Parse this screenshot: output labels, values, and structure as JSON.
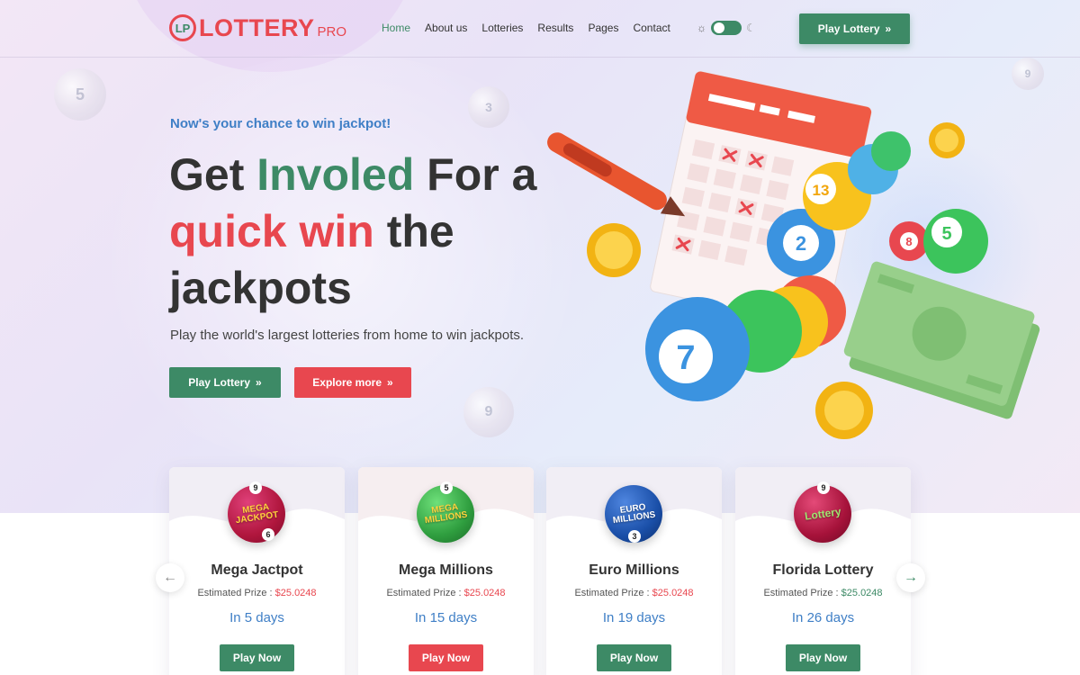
{
  "header": {
    "logo_mark": "LP",
    "logo_word": "LOTTERY",
    "logo_suffix": "PRO",
    "nav": [
      "Home",
      "About us",
      "Lotteries",
      "Results",
      "Pages",
      "Contact"
    ],
    "cta_label": "Play Lottery"
  },
  "hero": {
    "tagline": "Now's your chance to win jackpot!",
    "headline_part1": "Get ",
    "headline_green": "Involed",
    "headline_part2": " For a ",
    "headline_red": "quick win",
    "headline_part3": " the jackpots",
    "subtitle": "Play the world's largest lotteries from home to win jackpots.",
    "play_label": "Play Lottery",
    "explore_label": "Explore more"
  },
  "cards": [
    {
      "title": "Mega Jactpot",
      "prize_label": "Estimated Prize : ",
      "prize_value": "$25.0248",
      "days": "In 5 days",
      "button": "Play Now",
      "ball_text": "MEGA JACKPOT",
      "ball_color": "#b0163d"
    },
    {
      "title": "Mega Millions",
      "prize_label": "Estimated Prize : ",
      "prize_value": "$25.0248",
      "days": "In 15 days",
      "button": "Play Now",
      "ball_text": "MEGA MILLIONS",
      "ball_color": "#2f9e3f"
    },
    {
      "title": "Euro Millions",
      "prize_label": "Estimated Prize : ",
      "prize_value": "$25.0248",
      "days": "In 19 days",
      "button": "Play Now",
      "ball_text": "EURO MILLIONS",
      "ball_color": "#1a4fa8"
    },
    {
      "title": "Florida Lottery",
      "prize_label": "Estimated Prize : ",
      "prize_value": "$25.0248",
      "days": "In 26 days",
      "button": "Play Now",
      "ball_text": "Lottery",
      "ball_color": "#a6123a"
    }
  ],
  "colors": {
    "green": "#3d8a66",
    "red": "#e8474f",
    "blue": "#3f7fc6"
  },
  "icons": {
    "arrow_left": "arrow-left-icon",
    "arrow_right": "arrow-right-icon",
    "double_chevron": "double-chevron-right-icon"
  }
}
